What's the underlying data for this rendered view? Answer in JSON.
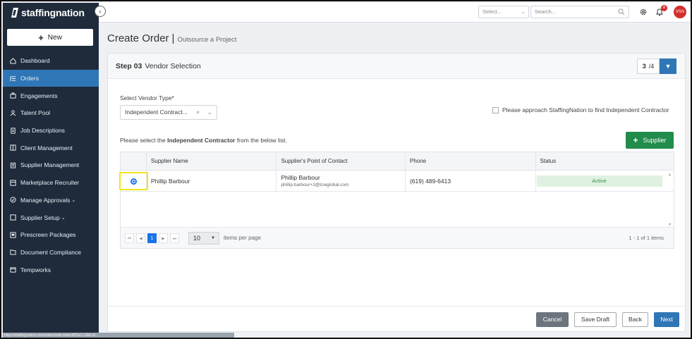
{
  "app": {
    "logo_text": "staffingnation"
  },
  "sidebar": {
    "new_label": "New",
    "items": [
      {
        "label": "Dashboard",
        "icon": "home-icon"
      },
      {
        "label": "Orders",
        "icon": "orders-icon",
        "active": true
      },
      {
        "label": "Engagements",
        "icon": "briefcase-icon"
      },
      {
        "label": "Talent Pool",
        "icon": "person-icon"
      },
      {
        "label": "Job Descriptions",
        "icon": "document-icon"
      },
      {
        "label": "Client Management",
        "icon": "building-icon"
      },
      {
        "label": "Supplier Management",
        "icon": "clipboard-icon"
      },
      {
        "label": "Marketplace Recruiter",
        "icon": "store-icon"
      },
      {
        "label": "Manage Approvals",
        "icon": "check-circle-icon",
        "caret": true
      },
      {
        "label": "Supplier Setup",
        "icon": "square-icon",
        "caret": true
      },
      {
        "label": "Prescreen Packages",
        "icon": "package-icon"
      },
      {
        "label": "Document Compliance",
        "icon": "folder-icon"
      },
      {
        "label": "Tempworks",
        "icon": "calendar-icon"
      }
    ],
    "status_url": "https://staffingnation.com/orders/edit-order/4f53a7-c3b6-4f..."
  },
  "topbar": {
    "select_placeholder": "Select...",
    "search_placeholder": "Search...",
    "notification_count": "8",
    "avatar_initials": "VSA"
  },
  "page": {
    "title": "Create Order",
    "separator": "|",
    "subtitle": "Outsource a Project"
  },
  "step": {
    "prefix": "Step 03",
    "name": "Vendor Selection",
    "current": "3",
    "total": "4"
  },
  "form": {
    "vendor_type_label": "Select Vendor Type*",
    "vendor_type_value": "Independent Contract...",
    "approach_label": "Please approach StaffingNation to find Independent Contractor",
    "instruction_pre": "Please select the ",
    "instruction_bold": "Independent Contractor",
    "instruction_post": " from the below list.",
    "add_supplier_label": "Supplier"
  },
  "grid": {
    "columns": [
      "",
      "Supplier Name",
      "Supplier's Point of Contact",
      "Phone",
      "Status"
    ],
    "rows": [
      {
        "selected": true,
        "supplier_name": "Phillip Barbour",
        "contact_name": "Phillip Barbour",
        "contact_email": "phillip.barbour+2@tcwglobal.com",
        "phone": "(619) 489-6413",
        "status": "Active"
      }
    ],
    "pager": {
      "first": "⏮",
      "prev": "◀",
      "page": "1",
      "next": "▶",
      "last": "⏭",
      "per_page": "10",
      "items_label": "items per page",
      "range": "1 - 1 of 1 items"
    }
  },
  "footer": {
    "cancel": "Cancel",
    "save_draft": "Save Draft",
    "back": "Back",
    "next": "Next"
  },
  "colors": {
    "sidebar_bg": "#1f2b3b",
    "active_nav": "#2f76b6",
    "success": "#218c4b",
    "primary": "#2f76b6",
    "highlight": "#f3e418"
  }
}
